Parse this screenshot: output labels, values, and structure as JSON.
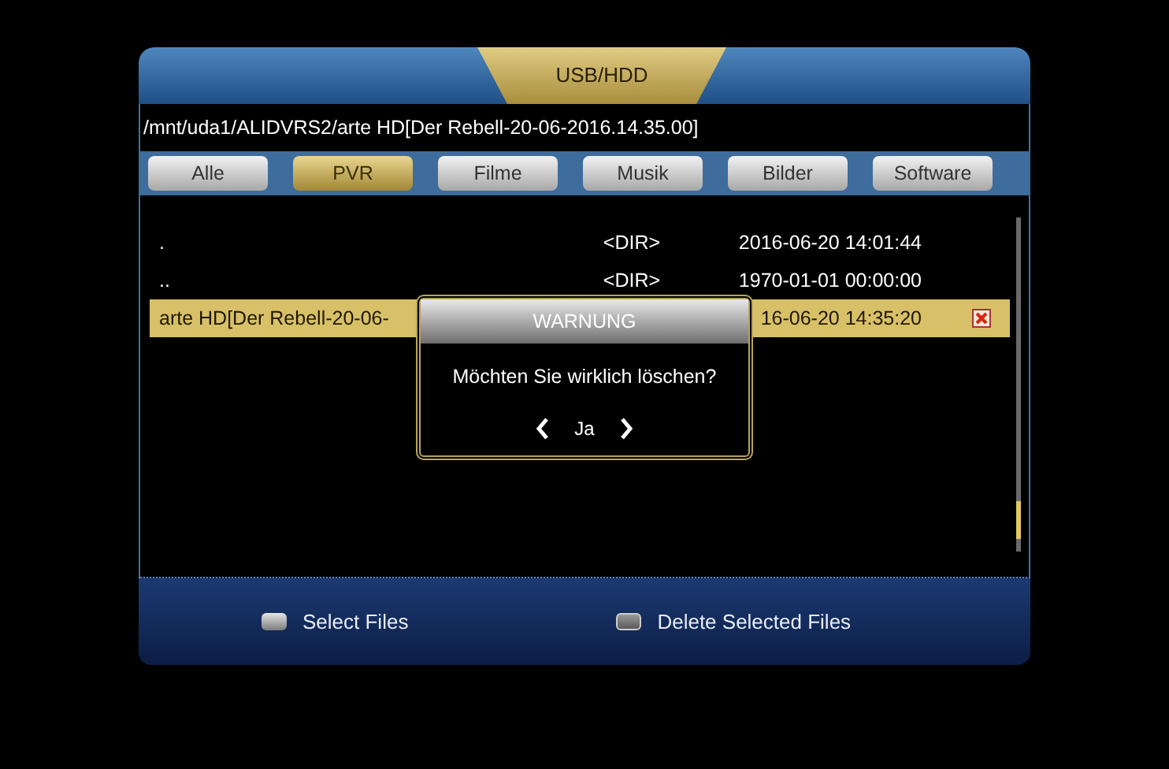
{
  "window": {
    "title": "USB/HDD"
  },
  "path": "/mnt/uda1/ALIDVRS2/arte HD[Der Rebell-20-06-2016.14.35.00]",
  "tabs": [
    {
      "label": "Alle",
      "selected": false
    },
    {
      "label": "PVR",
      "selected": true
    },
    {
      "label": "Filme",
      "selected": false
    },
    {
      "label": "Musik",
      "selected": false
    },
    {
      "label": "Bilder",
      "selected": false
    },
    {
      "label": "Software",
      "selected": false
    }
  ],
  "files": [
    {
      "name": ".",
      "size": "<DIR>",
      "date": "2016-06-20 14:01:44",
      "selected": false,
      "marked": false
    },
    {
      "name": "..",
      "size": "<DIR>",
      "date": "1970-01-01 00:00:00",
      "selected": false,
      "marked": false
    },
    {
      "name": "arte HD[Der Rebell-20-06-",
      "date": "16-06-20 14:35:20",
      "selected": true,
      "marked": true
    }
  ],
  "dialog": {
    "title": "WARNUNG",
    "message": "Möchten Sie wirklich löschen?",
    "choice": "Ja"
  },
  "footer": [
    {
      "kind": "ok",
      "label": "Select Files"
    },
    {
      "kind": "list",
      "label": "Delete Selected Files"
    }
  ]
}
